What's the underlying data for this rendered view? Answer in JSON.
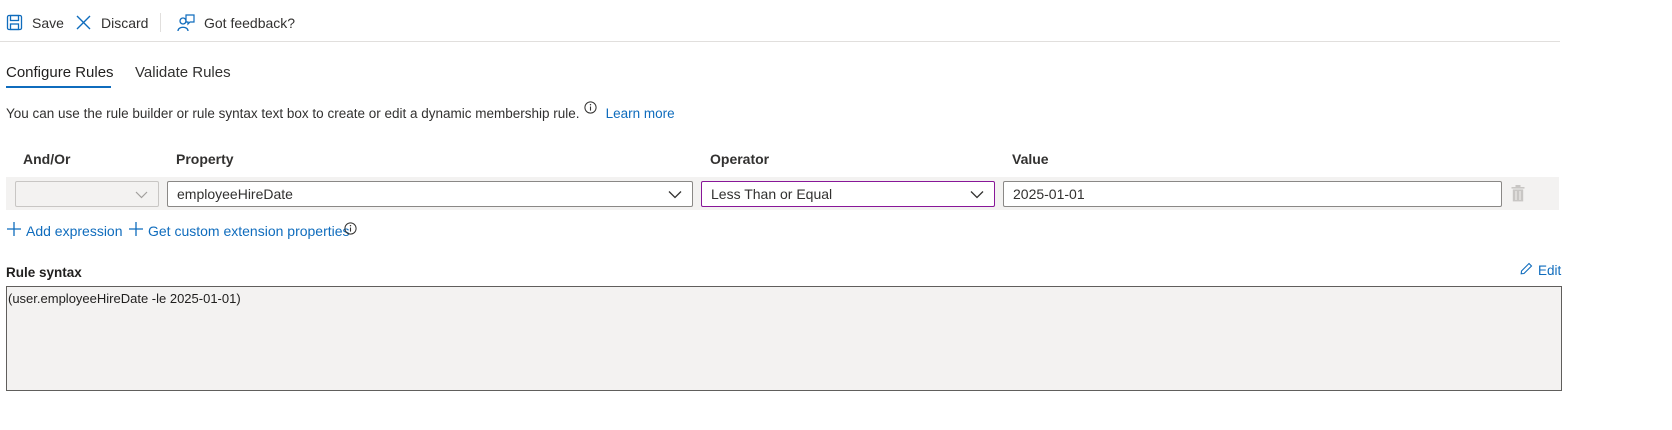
{
  "toolbar": {
    "save_label": "Save",
    "discard_label": "Discard",
    "feedback_label": "Got feedback?"
  },
  "tabs": [
    {
      "label": "Configure Rules",
      "active": true
    },
    {
      "label": "Validate Rules",
      "active": false
    }
  ],
  "info": {
    "text": "You can use the rule builder or rule syntax text box to create or edit a dynamic membership rule.",
    "learn_more": "Learn more"
  },
  "rule_table": {
    "headers": {
      "and_or": "And/Or",
      "property": "Property",
      "operator": "Operator",
      "value": "Value"
    },
    "rows": [
      {
        "and_or": "",
        "property": "employeeHireDate",
        "operator": "Less Than or Equal",
        "value": "2025-01-01"
      }
    ]
  },
  "actions": {
    "add_expression": "Add expression",
    "custom_ext": "Get custom extension properties"
  },
  "rule_syntax": {
    "label": "Rule syntax",
    "edit_label": "Edit",
    "text": "(user.employeeHireDate -le 2025-01-01)"
  },
  "colors": {
    "accent": "#0f6cbd",
    "focus_border": "#881798",
    "row_background": "#f3f2f1"
  }
}
